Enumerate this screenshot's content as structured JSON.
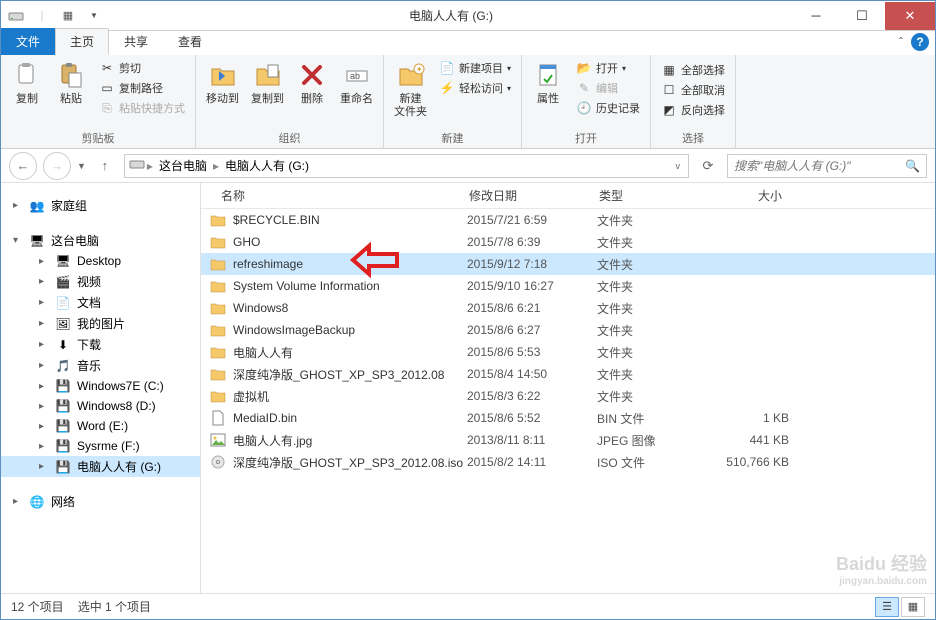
{
  "window_title": "电脑人人有 (G:)",
  "tabs": {
    "file": "文件",
    "home": "主页",
    "share": "共享",
    "view": "查看"
  },
  "ribbon": {
    "clipboard": {
      "copy": "复制",
      "paste": "粘贴",
      "cut": "剪切",
      "copy_path": "复制路径",
      "paste_shortcut": "粘贴快捷方式",
      "label": "剪贴板"
    },
    "organize": {
      "move_to": "移动到",
      "copy_to": "复制到",
      "delete": "删除",
      "rename": "重命名",
      "label": "组织"
    },
    "new": {
      "new_folder": "新建\n文件夹",
      "new_item": "新建项目",
      "easy_access": "轻松访问",
      "label": "新建"
    },
    "open": {
      "properties": "属性",
      "open": "打开",
      "edit": "编辑",
      "history": "历史记录",
      "label": "打开"
    },
    "select": {
      "select_all": "全部选择",
      "select_none": "全部取消",
      "invert": "反向选择",
      "label": "选择"
    }
  },
  "breadcrumb": {
    "this_pc": "这台电脑",
    "drive": "电脑人人有 (G:)"
  },
  "search_placeholder": "搜索\"电脑人人有 (G:)\"",
  "nav": {
    "homegroup": "家庭组",
    "this_pc": "这台电脑",
    "items": [
      "Desktop",
      "视频",
      "文档",
      "我的图片",
      "下载",
      "音乐",
      "Windows7E (C:)",
      "Windows8 (D:)",
      "Word (E:)",
      "Sysrme (F:)",
      "电脑人人有 (G:)"
    ],
    "network": "网络"
  },
  "columns": {
    "name": "名称",
    "date": "修改日期",
    "type": "类型",
    "size": "大小"
  },
  "files": [
    {
      "name": "$RECYCLE.BIN",
      "date": "2015/7/21 6:59",
      "type": "文件夹",
      "size": "",
      "icon": "folder"
    },
    {
      "name": "GHO",
      "date": "2015/7/8 6:39",
      "type": "文件夹",
      "size": "",
      "icon": "folder"
    },
    {
      "name": "refreshimage",
      "date": "2015/9/12 7:18",
      "type": "文件夹",
      "size": "",
      "icon": "folder",
      "selected": true
    },
    {
      "name": "System Volume Information",
      "date": "2015/9/10 16:27",
      "type": "文件夹",
      "size": "",
      "icon": "folder"
    },
    {
      "name": "Windows8",
      "date": "2015/8/6 6:21",
      "type": "文件夹",
      "size": "",
      "icon": "folder"
    },
    {
      "name": "WindowsImageBackup",
      "date": "2015/8/6 6:27",
      "type": "文件夹",
      "size": "",
      "icon": "folder"
    },
    {
      "name": "电脑人人有",
      "date": "2015/8/6 5:53",
      "type": "文件夹",
      "size": "",
      "icon": "folder-link"
    },
    {
      "name": "深度纯净版_GHOST_XP_SP3_2012.08",
      "date": "2015/8/4 14:50",
      "type": "文件夹",
      "size": "",
      "icon": "folder"
    },
    {
      "name": "虚拟机",
      "date": "2015/8/3 6:22",
      "type": "文件夹",
      "size": "",
      "icon": "folder"
    },
    {
      "name": "MediaID.bin",
      "date": "2015/8/6 5:52",
      "type": "BIN 文件",
      "size": "1 KB",
      "icon": "file"
    },
    {
      "name": "电脑人人有.jpg",
      "date": "2013/8/11 8:11",
      "type": "JPEG 图像",
      "size": "441 KB",
      "icon": "image"
    },
    {
      "name": "深度纯净版_GHOST_XP_SP3_2012.08.iso",
      "date": "2015/8/2 14:11",
      "type": "ISO 文件",
      "size": "510,766 KB",
      "icon": "iso"
    }
  ],
  "status": {
    "count": "12 个项目",
    "selected": "选中 1 个项目"
  },
  "watermark": {
    "main": "Baidu 经验",
    "sub": "jingyan.baidu.com"
  }
}
